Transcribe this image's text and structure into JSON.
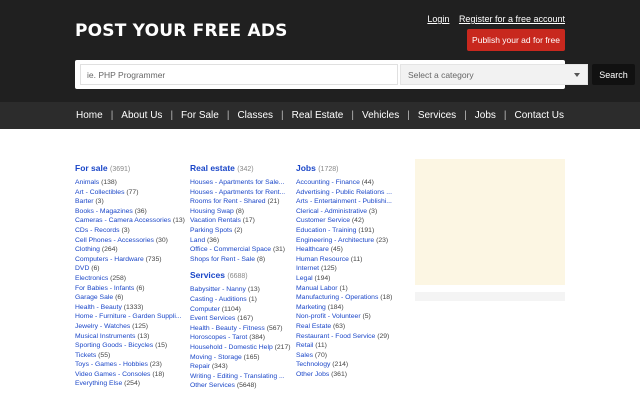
{
  "header": {
    "title": "POST YOUR FREE ADS",
    "login_label": "Login",
    "register_label": "Register for a free account",
    "post_ad_label": "Publish your ad for free"
  },
  "search": {
    "placeholder": "ie. PHP Programmer",
    "category_label": "Select a category",
    "button_label": "Search"
  },
  "nav": {
    "items": [
      "Home",
      "About Us",
      "For Sale",
      "Classes",
      "Real Estate",
      "Vehicles",
      "Services",
      "Jobs",
      "Contact Us"
    ]
  },
  "categories": {
    "for_sale": {
      "title": "For sale",
      "count": "(3691)",
      "items": [
        {
          "label": "Animals",
          "count": "(138)"
        },
        {
          "label": "Art - Collectibles",
          "count": "(77)"
        },
        {
          "label": "Barter",
          "count": "(3)"
        },
        {
          "label": "Books - Magazines",
          "count": "(36)"
        },
        {
          "label": "Cameras - Camera Accessories",
          "count": "(13)"
        },
        {
          "label": "CDs - Records",
          "count": "(3)"
        },
        {
          "label": "Cell Phones - Accessories",
          "count": "(30)"
        },
        {
          "label": "Clothing",
          "count": "(264)"
        },
        {
          "label": "Computers - Hardware",
          "count": "(735)"
        },
        {
          "label": "DVD",
          "count": "(6)"
        },
        {
          "label": "Electronics",
          "count": "(258)"
        },
        {
          "label": "For Babies - Infants",
          "count": "(6)"
        },
        {
          "label": "Garage Sale",
          "count": "(6)"
        },
        {
          "label": "Health - Beauty",
          "count": "(1333)"
        },
        {
          "label": "Home - Furniture - Garden Suppli...",
          "count": ""
        },
        {
          "label": "Jewelry - Watches",
          "count": "(125)"
        },
        {
          "label": "Musical Instruments",
          "count": "(13)"
        },
        {
          "label": "Sporting Goods - Bicycles",
          "count": "(15)"
        },
        {
          "label": "Tickets",
          "count": "(55)"
        },
        {
          "label": "Toys - Games - Hobbies",
          "count": "(23)"
        },
        {
          "label": "Video Games - Consoles",
          "count": "(18)"
        },
        {
          "label": "Everything Else",
          "count": "(254)"
        }
      ]
    },
    "real_estate": {
      "title": "Real estate",
      "count": "(342)",
      "items": [
        {
          "label": "Houses - Apartments for Sale...",
          "count": ""
        },
        {
          "label": "Houses - Apartments for Rent...",
          "count": ""
        },
        {
          "label": "Rooms for Rent - Shared",
          "count": "(21)"
        },
        {
          "label": "Housing Swap",
          "count": "(8)"
        },
        {
          "label": "Vacation Rentals",
          "count": "(17)"
        },
        {
          "label": "Parking Spots",
          "count": "(2)"
        },
        {
          "label": "Land",
          "count": "(36)"
        },
        {
          "label": "Office - Commercial Space",
          "count": "(31)"
        },
        {
          "label": "Shops for Rent - Sale",
          "count": "(8)"
        }
      ]
    },
    "services": {
      "title": "Services",
      "count": "(6688)",
      "items": [
        {
          "label": "Babysitter - Nanny",
          "count": "(13)"
        },
        {
          "label": "Casting - Auditions",
          "count": "(1)"
        },
        {
          "label": "Computer",
          "count": "(1104)"
        },
        {
          "label": "Event Services",
          "count": "(167)"
        },
        {
          "label": "Health - Beauty - Fitness",
          "count": "(567)"
        },
        {
          "label": "Horoscopes - Tarot",
          "count": "(384)"
        },
        {
          "label": "Household - Domestic Help",
          "count": "(217)"
        },
        {
          "label": "Moving - Storage",
          "count": "(165)"
        },
        {
          "label": "Repair",
          "count": "(343)"
        },
        {
          "label": "Writing - Editing - Translating ...",
          "count": ""
        },
        {
          "label": "Other Services",
          "count": "(5648)"
        }
      ]
    },
    "jobs": {
      "title": "Jobs",
      "count": "(1728)",
      "items": [
        {
          "label": "Accounting - Finance",
          "count": "(44)"
        },
        {
          "label": "Advertising - Public Relations ...",
          "count": ""
        },
        {
          "label": "Arts - Entertainment - Publishi...",
          "count": ""
        },
        {
          "label": "Clerical - Administrative",
          "count": "(3)"
        },
        {
          "label": "Customer Service",
          "count": "(42)"
        },
        {
          "label": "Education - Training",
          "count": "(191)"
        },
        {
          "label": "Engineering - Architecture",
          "count": "(23)"
        },
        {
          "label": "Healthcare",
          "count": "(45)"
        },
        {
          "label": "Human Resource",
          "count": "(11)"
        },
        {
          "label": "Internet",
          "count": "(125)"
        },
        {
          "label": "Legal",
          "count": "(194)"
        },
        {
          "label": "Manual Labor",
          "count": "(1)"
        },
        {
          "label": "Manufacturing - Operations",
          "count": "(18)"
        },
        {
          "label": "Marketing",
          "count": "(184)"
        },
        {
          "label": "Non-profit - Volunteer",
          "count": "(5)"
        },
        {
          "label": "Real Estate",
          "count": "(63)"
        },
        {
          "label": "Restaurant - Food Service",
          "count": "(29)"
        },
        {
          "label": "Retail",
          "count": "(11)"
        },
        {
          "label": "Sales",
          "count": "(70)"
        },
        {
          "label": "Technology",
          "count": "(214)"
        },
        {
          "label": "Other Jobs",
          "count": "(361)"
        }
      ]
    }
  },
  "colors": {
    "header_bg": "#202020",
    "nav_bg": "#2c2c2c",
    "accent_button": "#c8281e",
    "link": "#1a46c8",
    "ad_box": "#fcf6e3"
  }
}
